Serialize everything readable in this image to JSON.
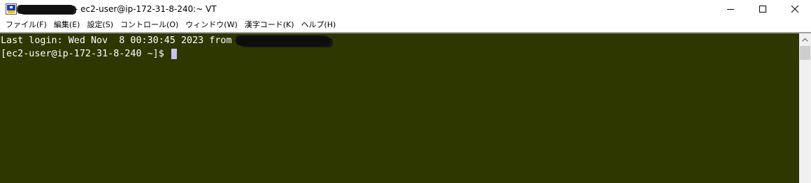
{
  "window": {
    "title": "- ec2-user@ip-172-31-8-240:~ VT"
  },
  "menu": {
    "items": [
      {
        "label": "ファイル(F)"
      },
      {
        "label": "編集(E)"
      },
      {
        "label": "設定(S)"
      },
      {
        "label": "コントロール(O)"
      },
      {
        "label": "ウィンドウ(W)"
      },
      {
        "label": "漢字コード(K)"
      },
      {
        "label": "ヘルプ(H)"
      }
    ]
  },
  "terminal": {
    "last_login": "Last login: Wed Nov  8 00:30:45 2023 from ",
    "prompt": "[ec2-user@ip-172-31-8-240 ~]$ ",
    "background": "#2e3700",
    "foreground": "#ffffff",
    "cursor_color": "#c8c0f0"
  },
  "icons": {
    "app": "teraterm-icon",
    "minimize": "minimize-icon",
    "maximize": "maximize-icon",
    "close": "close-icon",
    "scroll_up": "chevron-up-icon"
  }
}
